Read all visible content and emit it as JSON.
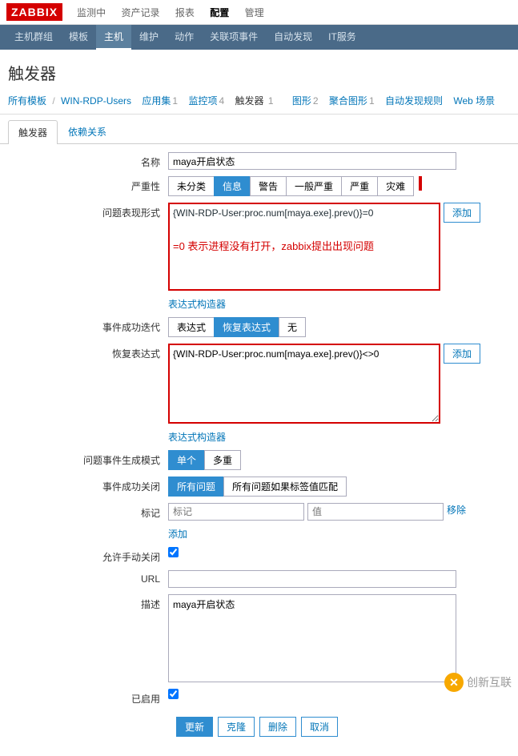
{
  "logo": "ZABBIX",
  "topnav": [
    "监测中",
    "资产记录",
    "报表",
    "配置",
    "管理"
  ],
  "topnav_active": 3,
  "subnav": [
    "主机群组",
    "模板",
    "主机",
    "维护",
    "动作",
    "关联项事件",
    "自动发现",
    "IT服务"
  ],
  "subnav_active": 2,
  "page_title": "触发器",
  "breadcrumb": {
    "all_templates": "所有模板",
    "host": "WIN-RDP-Users",
    "items": [
      {
        "label": "应用集",
        "count": "1"
      },
      {
        "label": "监控项",
        "count": "4"
      },
      {
        "label": "触发器",
        "count": "1",
        "current": true
      },
      {
        "label": "图形",
        "count": "2"
      },
      {
        "label": "聚合图形",
        "count": "1"
      },
      {
        "label": "自动发现规则",
        "count": ""
      },
      {
        "label": "Web 场景",
        "count": ""
      }
    ]
  },
  "tabs": {
    "trigger": "触发器",
    "deps": "依赖关系"
  },
  "form": {
    "name_label": "名称",
    "name_value": "maya开启状态",
    "severity_label": "严重性",
    "severity_opts": [
      "未分类",
      "信息",
      "警告",
      "一般严重",
      "严重",
      "灾难"
    ],
    "severity_sel": 1,
    "expr_label": "问题表现形式",
    "expr_value": "{WIN-RDP-User:proc.num[maya.exe].prev()}=0",
    "expr_note": "=0   表示进程没有打开，zabbix提出出现问题",
    "add": "添加",
    "expr_builder": "表达式构造器",
    "event_ok_gen_label": "事件成功迭代",
    "event_ok_gen_opts": [
      "表达式",
      "恢复表达式",
      "无"
    ],
    "event_ok_gen_sel": 1,
    "recovery_label": "恢复表达式",
    "recovery_value": "{WIN-RDP-User:proc.num[maya.exe].prev()}<>0",
    "problem_mode_label": "问题事件生成模式",
    "problem_mode_opts": [
      "单个",
      "多重"
    ],
    "problem_mode_sel": 0,
    "ok_close_label": "事件成功关闭",
    "ok_close_opts": [
      "所有问题",
      "所有问题如果标签值匹配"
    ],
    "ok_close_sel": 0,
    "tags_label": "标记",
    "tag_ph": "标记",
    "val_ph": "值",
    "remove": "移除",
    "manual_close_label": "允许手动关闭",
    "url_label": "URL",
    "url_value": "",
    "desc_label": "描述",
    "desc_value": "maya开启状态",
    "enabled_label": "已启用",
    "btns": {
      "update": "更新",
      "clone": "克隆",
      "delete": "删除",
      "cancel": "取消"
    }
  },
  "watermark": "创新互联"
}
